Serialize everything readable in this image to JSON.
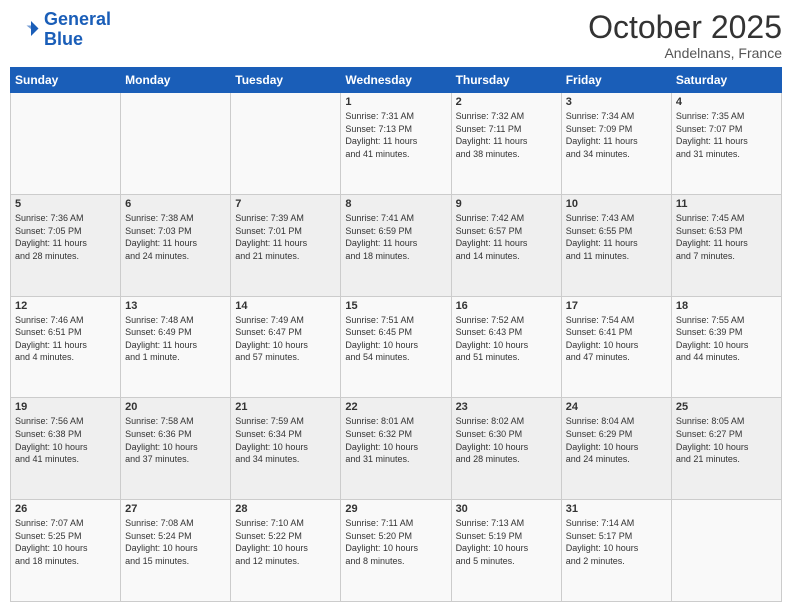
{
  "header": {
    "logo_line1": "General",
    "logo_line2": "Blue",
    "month_title": "October 2025",
    "location": "Andelnans, France"
  },
  "days_of_week": [
    "Sunday",
    "Monday",
    "Tuesday",
    "Wednesday",
    "Thursday",
    "Friday",
    "Saturday"
  ],
  "weeks": [
    [
      {
        "day": "",
        "info": ""
      },
      {
        "day": "",
        "info": ""
      },
      {
        "day": "",
        "info": ""
      },
      {
        "day": "1",
        "info": "Sunrise: 7:31 AM\nSunset: 7:13 PM\nDaylight: 11 hours\nand 41 minutes."
      },
      {
        "day": "2",
        "info": "Sunrise: 7:32 AM\nSunset: 7:11 PM\nDaylight: 11 hours\nand 38 minutes."
      },
      {
        "day": "3",
        "info": "Sunrise: 7:34 AM\nSunset: 7:09 PM\nDaylight: 11 hours\nand 34 minutes."
      },
      {
        "day": "4",
        "info": "Sunrise: 7:35 AM\nSunset: 7:07 PM\nDaylight: 11 hours\nand 31 minutes."
      }
    ],
    [
      {
        "day": "5",
        "info": "Sunrise: 7:36 AM\nSunset: 7:05 PM\nDaylight: 11 hours\nand 28 minutes."
      },
      {
        "day": "6",
        "info": "Sunrise: 7:38 AM\nSunset: 7:03 PM\nDaylight: 11 hours\nand 24 minutes."
      },
      {
        "day": "7",
        "info": "Sunrise: 7:39 AM\nSunset: 7:01 PM\nDaylight: 11 hours\nand 21 minutes."
      },
      {
        "day": "8",
        "info": "Sunrise: 7:41 AM\nSunset: 6:59 PM\nDaylight: 11 hours\nand 18 minutes."
      },
      {
        "day": "9",
        "info": "Sunrise: 7:42 AM\nSunset: 6:57 PM\nDaylight: 11 hours\nand 14 minutes."
      },
      {
        "day": "10",
        "info": "Sunrise: 7:43 AM\nSunset: 6:55 PM\nDaylight: 11 hours\nand 11 minutes."
      },
      {
        "day": "11",
        "info": "Sunrise: 7:45 AM\nSunset: 6:53 PM\nDaylight: 11 hours\nand 7 minutes."
      }
    ],
    [
      {
        "day": "12",
        "info": "Sunrise: 7:46 AM\nSunset: 6:51 PM\nDaylight: 11 hours\nand 4 minutes."
      },
      {
        "day": "13",
        "info": "Sunrise: 7:48 AM\nSunset: 6:49 PM\nDaylight: 11 hours\nand 1 minute."
      },
      {
        "day": "14",
        "info": "Sunrise: 7:49 AM\nSunset: 6:47 PM\nDaylight: 10 hours\nand 57 minutes."
      },
      {
        "day": "15",
        "info": "Sunrise: 7:51 AM\nSunset: 6:45 PM\nDaylight: 10 hours\nand 54 minutes."
      },
      {
        "day": "16",
        "info": "Sunrise: 7:52 AM\nSunset: 6:43 PM\nDaylight: 10 hours\nand 51 minutes."
      },
      {
        "day": "17",
        "info": "Sunrise: 7:54 AM\nSunset: 6:41 PM\nDaylight: 10 hours\nand 47 minutes."
      },
      {
        "day": "18",
        "info": "Sunrise: 7:55 AM\nSunset: 6:39 PM\nDaylight: 10 hours\nand 44 minutes."
      }
    ],
    [
      {
        "day": "19",
        "info": "Sunrise: 7:56 AM\nSunset: 6:38 PM\nDaylight: 10 hours\nand 41 minutes."
      },
      {
        "day": "20",
        "info": "Sunrise: 7:58 AM\nSunset: 6:36 PM\nDaylight: 10 hours\nand 37 minutes."
      },
      {
        "day": "21",
        "info": "Sunrise: 7:59 AM\nSunset: 6:34 PM\nDaylight: 10 hours\nand 34 minutes."
      },
      {
        "day": "22",
        "info": "Sunrise: 8:01 AM\nSunset: 6:32 PM\nDaylight: 10 hours\nand 31 minutes."
      },
      {
        "day": "23",
        "info": "Sunrise: 8:02 AM\nSunset: 6:30 PM\nDaylight: 10 hours\nand 28 minutes."
      },
      {
        "day": "24",
        "info": "Sunrise: 8:04 AM\nSunset: 6:29 PM\nDaylight: 10 hours\nand 24 minutes."
      },
      {
        "day": "25",
        "info": "Sunrise: 8:05 AM\nSunset: 6:27 PM\nDaylight: 10 hours\nand 21 minutes."
      }
    ],
    [
      {
        "day": "26",
        "info": "Sunrise: 7:07 AM\nSunset: 5:25 PM\nDaylight: 10 hours\nand 18 minutes."
      },
      {
        "day": "27",
        "info": "Sunrise: 7:08 AM\nSunset: 5:24 PM\nDaylight: 10 hours\nand 15 minutes."
      },
      {
        "day": "28",
        "info": "Sunrise: 7:10 AM\nSunset: 5:22 PM\nDaylight: 10 hours\nand 12 minutes."
      },
      {
        "day": "29",
        "info": "Sunrise: 7:11 AM\nSunset: 5:20 PM\nDaylight: 10 hours\nand 8 minutes."
      },
      {
        "day": "30",
        "info": "Sunrise: 7:13 AM\nSunset: 5:19 PM\nDaylight: 10 hours\nand 5 minutes."
      },
      {
        "day": "31",
        "info": "Sunrise: 7:14 AM\nSunset: 5:17 PM\nDaylight: 10 hours\nand 2 minutes."
      },
      {
        "day": "",
        "info": ""
      }
    ]
  ]
}
